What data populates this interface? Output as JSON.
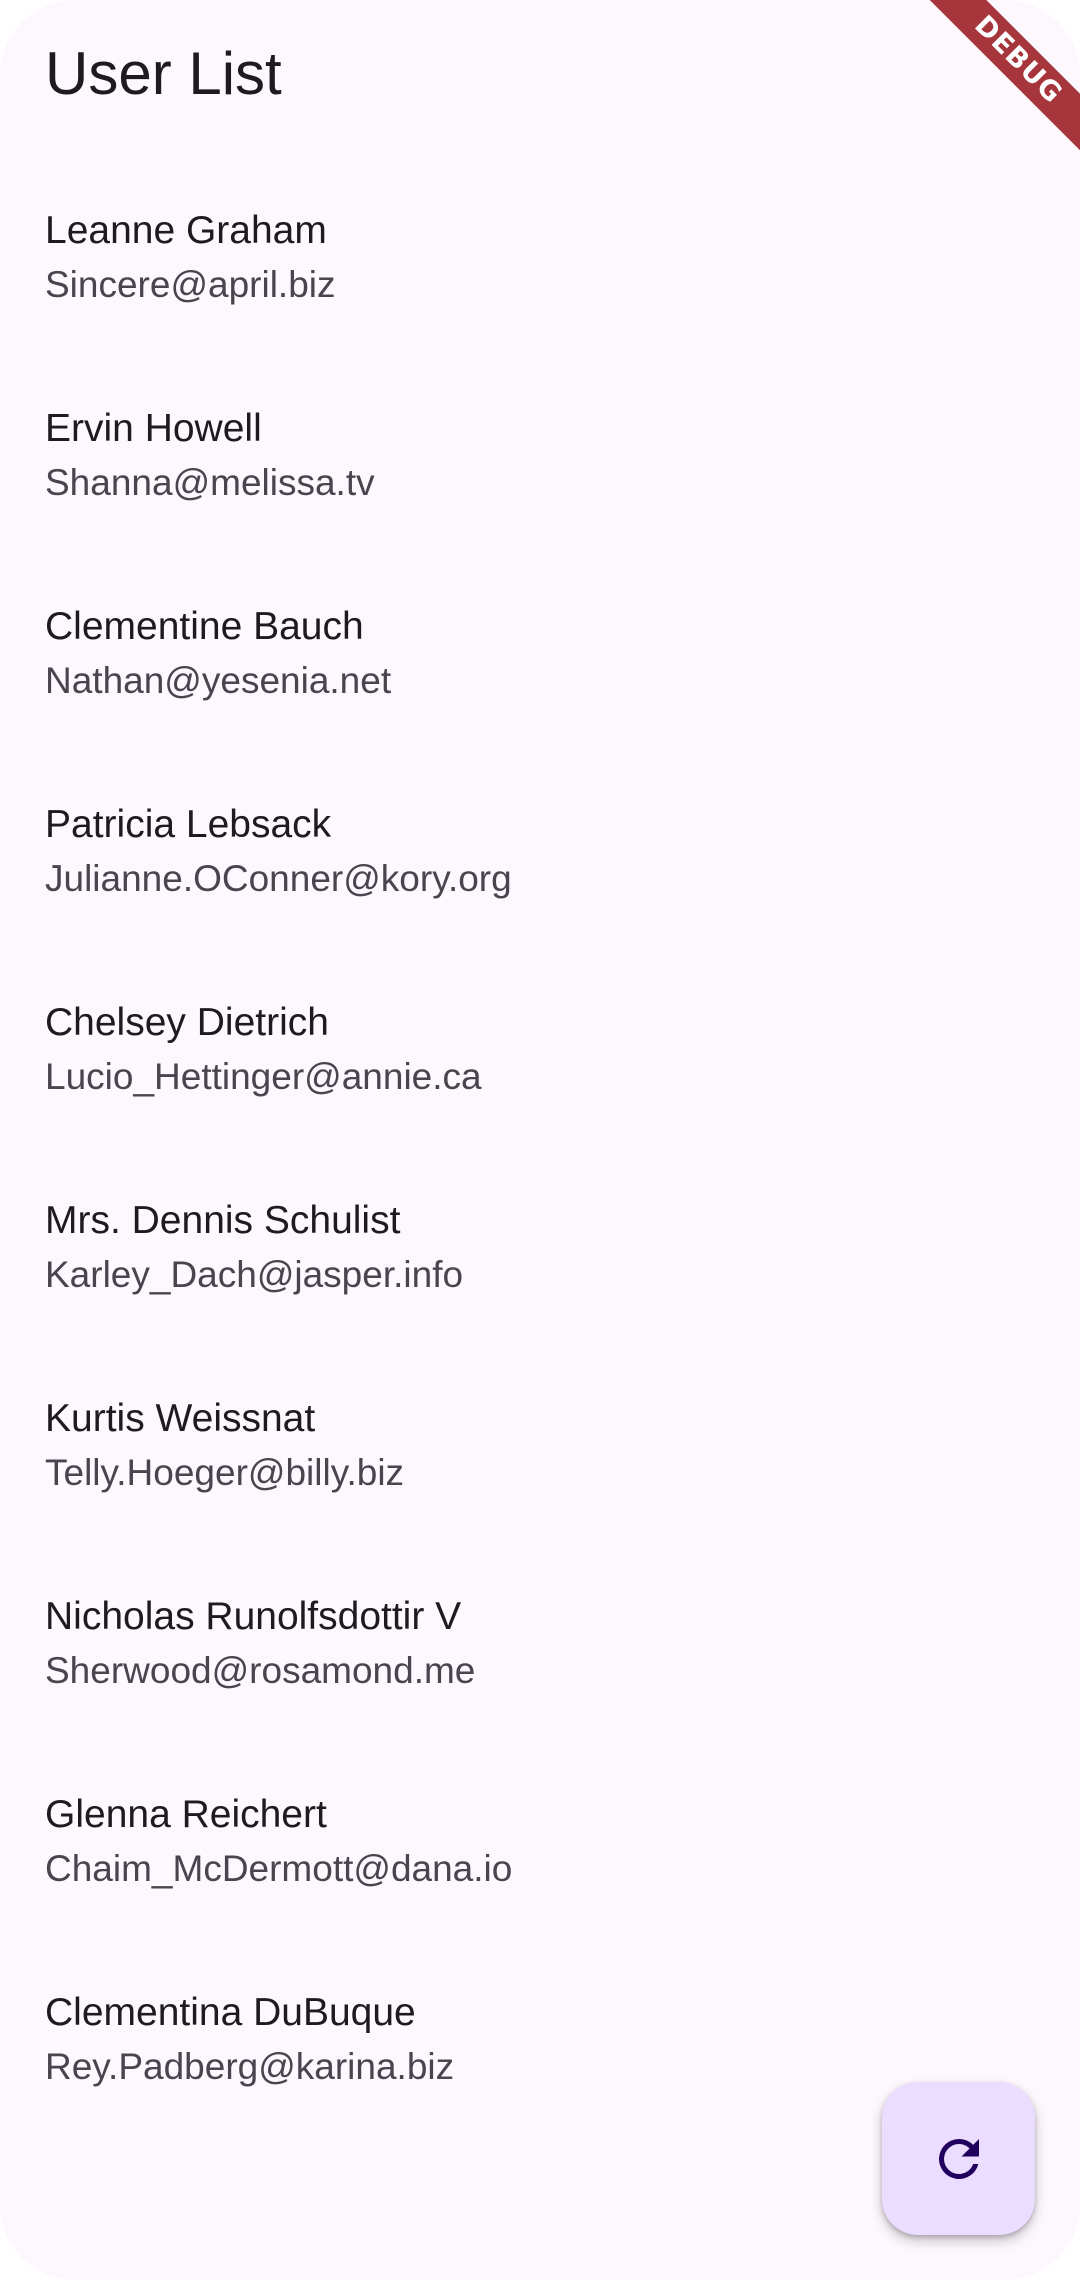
{
  "app_bar": {
    "title": "User List"
  },
  "users": [
    {
      "name": "Leanne Graham",
      "email": "Sincere@april.biz"
    },
    {
      "name": "Ervin Howell",
      "email": "Shanna@melissa.tv"
    },
    {
      "name": "Clementine Bauch",
      "email": "Nathan@yesenia.net"
    },
    {
      "name": "Patricia Lebsack",
      "email": "Julianne.OConner@kory.org"
    },
    {
      "name": "Chelsey Dietrich",
      "email": "Lucio_Hettinger@annie.ca"
    },
    {
      "name": "Mrs. Dennis Schulist",
      "email": "Karley_Dach@jasper.info"
    },
    {
      "name": "Kurtis Weissnat",
      "email": "Telly.Hoeger@billy.biz"
    },
    {
      "name": "Nicholas Runolfsdottir V",
      "email": "Sherwood@rosamond.me"
    },
    {
      "name": "Glenna Reichert",
      "email": "Chaim_McDermott@dana.io"
    },
    {
      "name": "Clementina DuBuque",
      "email": "Rey.Padberg@karina.biz"
    }
  ],
  "fab": {
    "icon": "refresh-icon"
  },
  "debug_banner": {
    "label": "DEBUG"
  },
  "colors": {
    "background": "#fdf7fe",
    "primary_text": "#1d1b20",
    "secondary_text": "#49454f",
    "fab_background": "#eaddff",
    "fab_icon": "#21005d",
    "debug_banner": "#a6363c"
  }
}
